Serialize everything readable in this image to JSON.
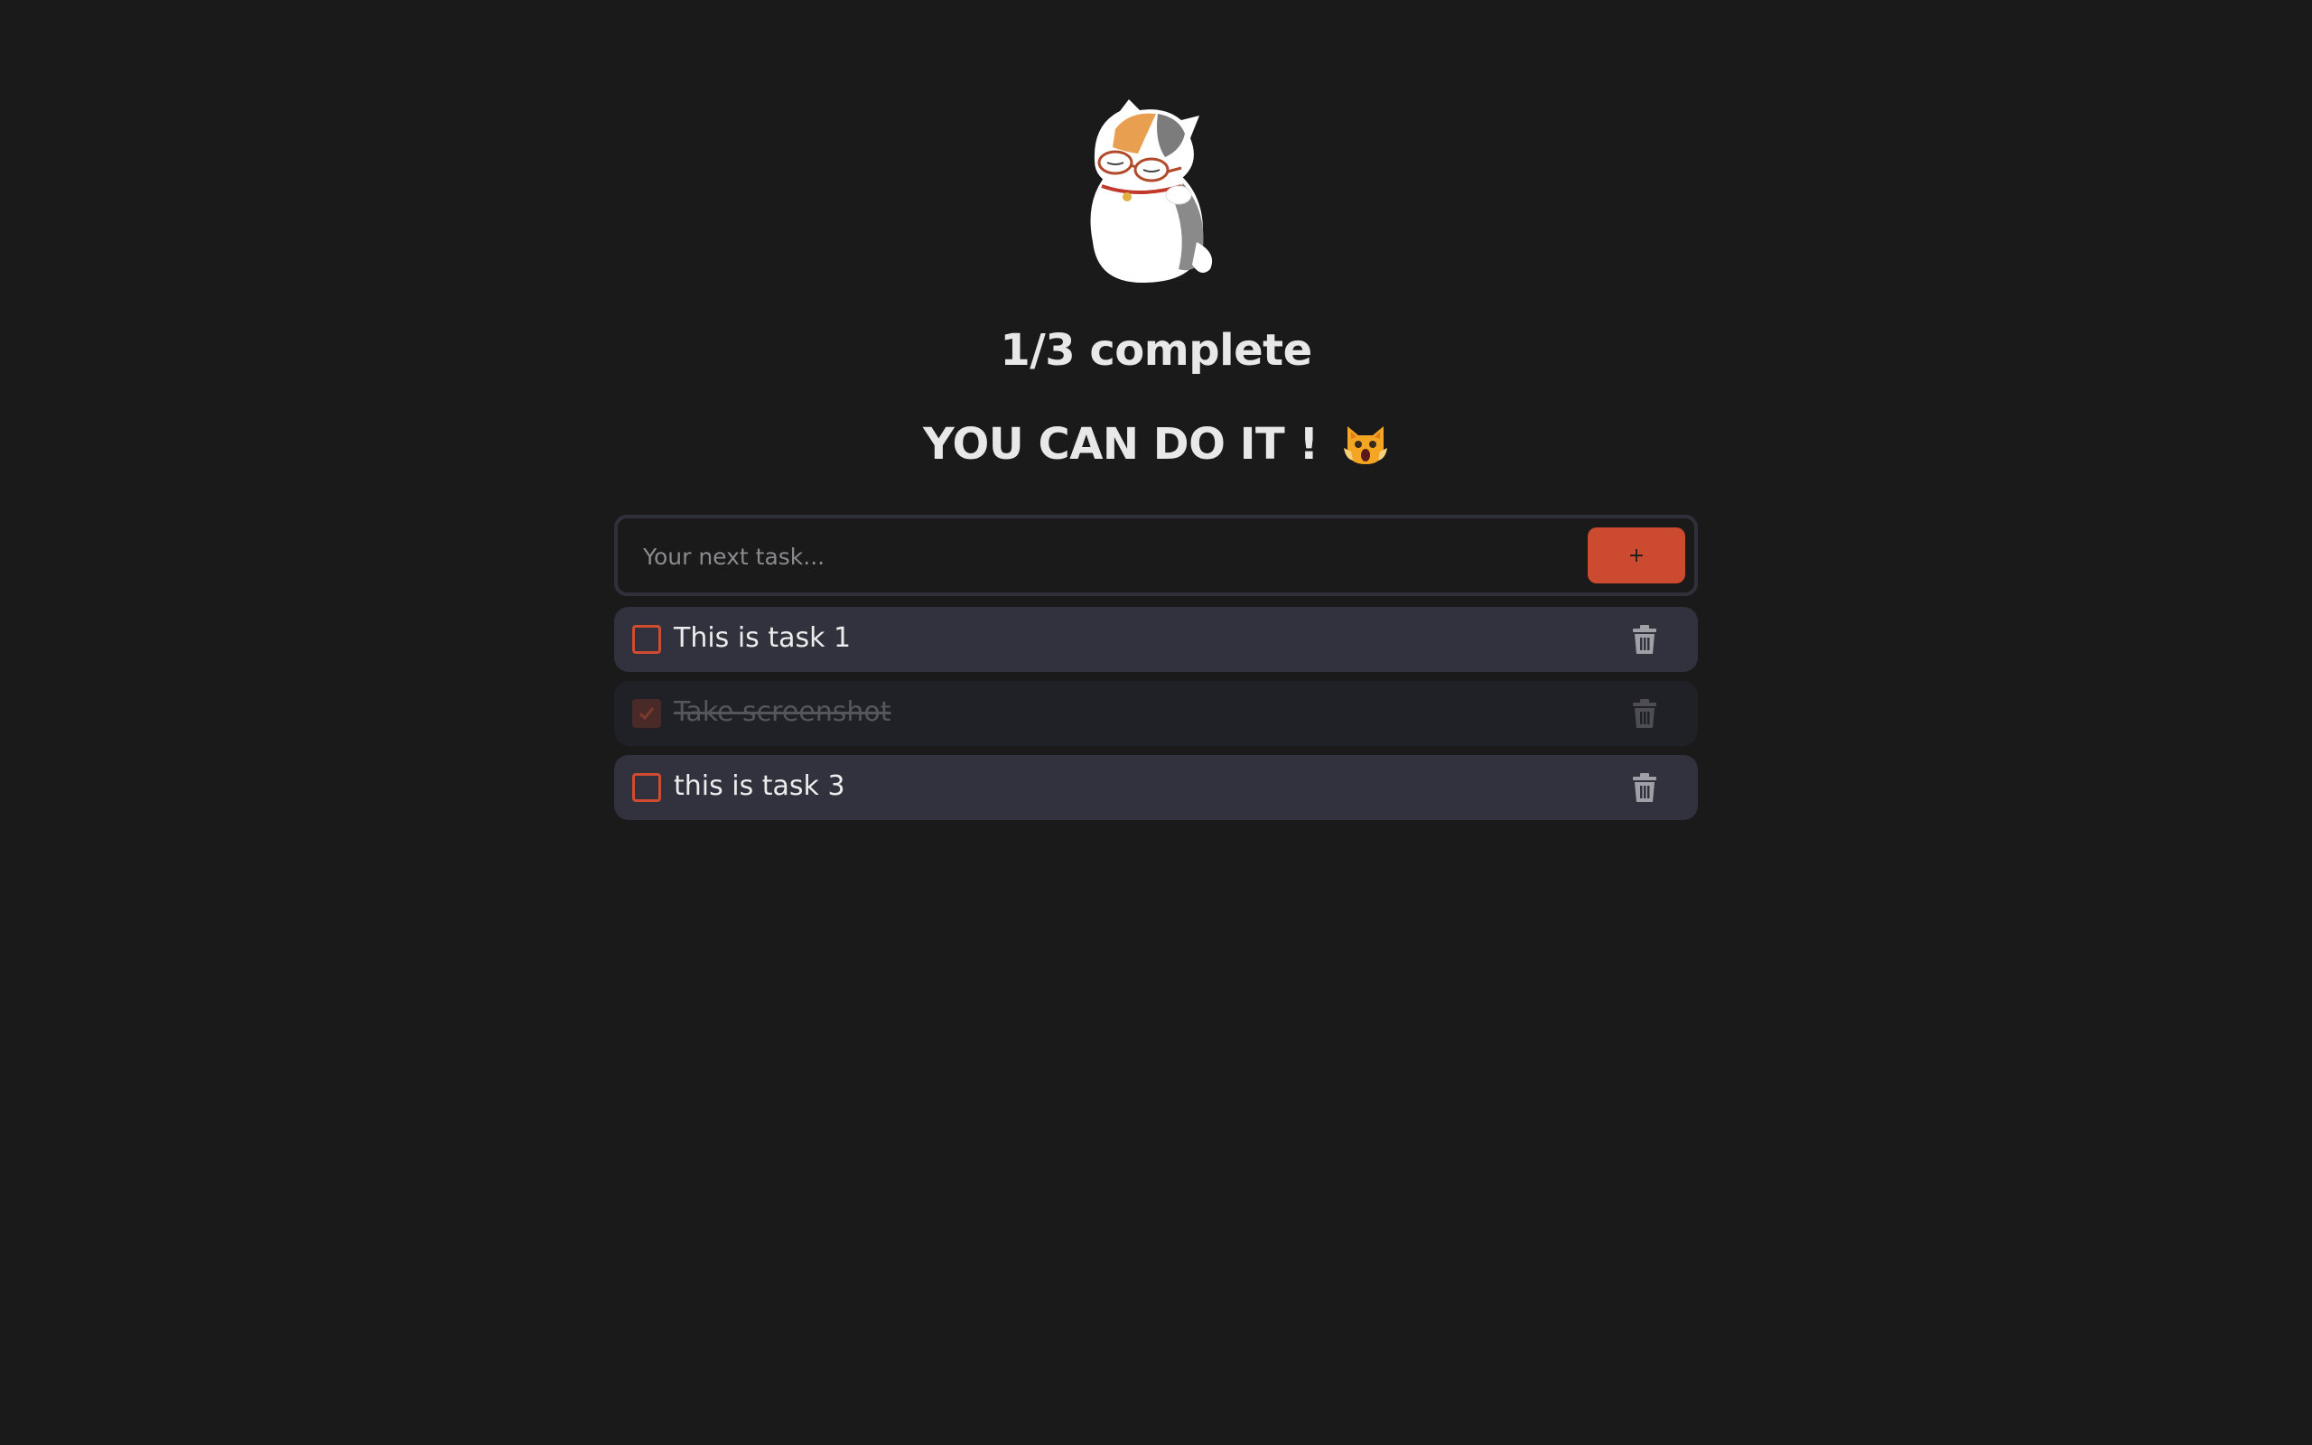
{
  "header": {
    "mascot_icon": "cat-mascot-with-glasses",
    "progress_text": "1/3 complete",
    "motivation_text": "YOU CAN DO IT !",
    "motivation_emoji": "screaming-cat-emoji"
  },
  "new_task": {
    "placeholder": "Your next task...",
    "value": "",
    "add_label": "+"
  },
  "tasks": [
    {
      "label": "This is task 1",
      "completed": false
    },
    {
      "label": "Take screenshot",
      "completed": true
    },
    {
      "label": "this is task 3",
      "completed": false
    }
  ],
  "colors": {
    "background": "#1a1a1a",
    "accent": "#cc4a30",
    "task_background": "#32323f",
    "task_done_background": "#202027"
  }
}
